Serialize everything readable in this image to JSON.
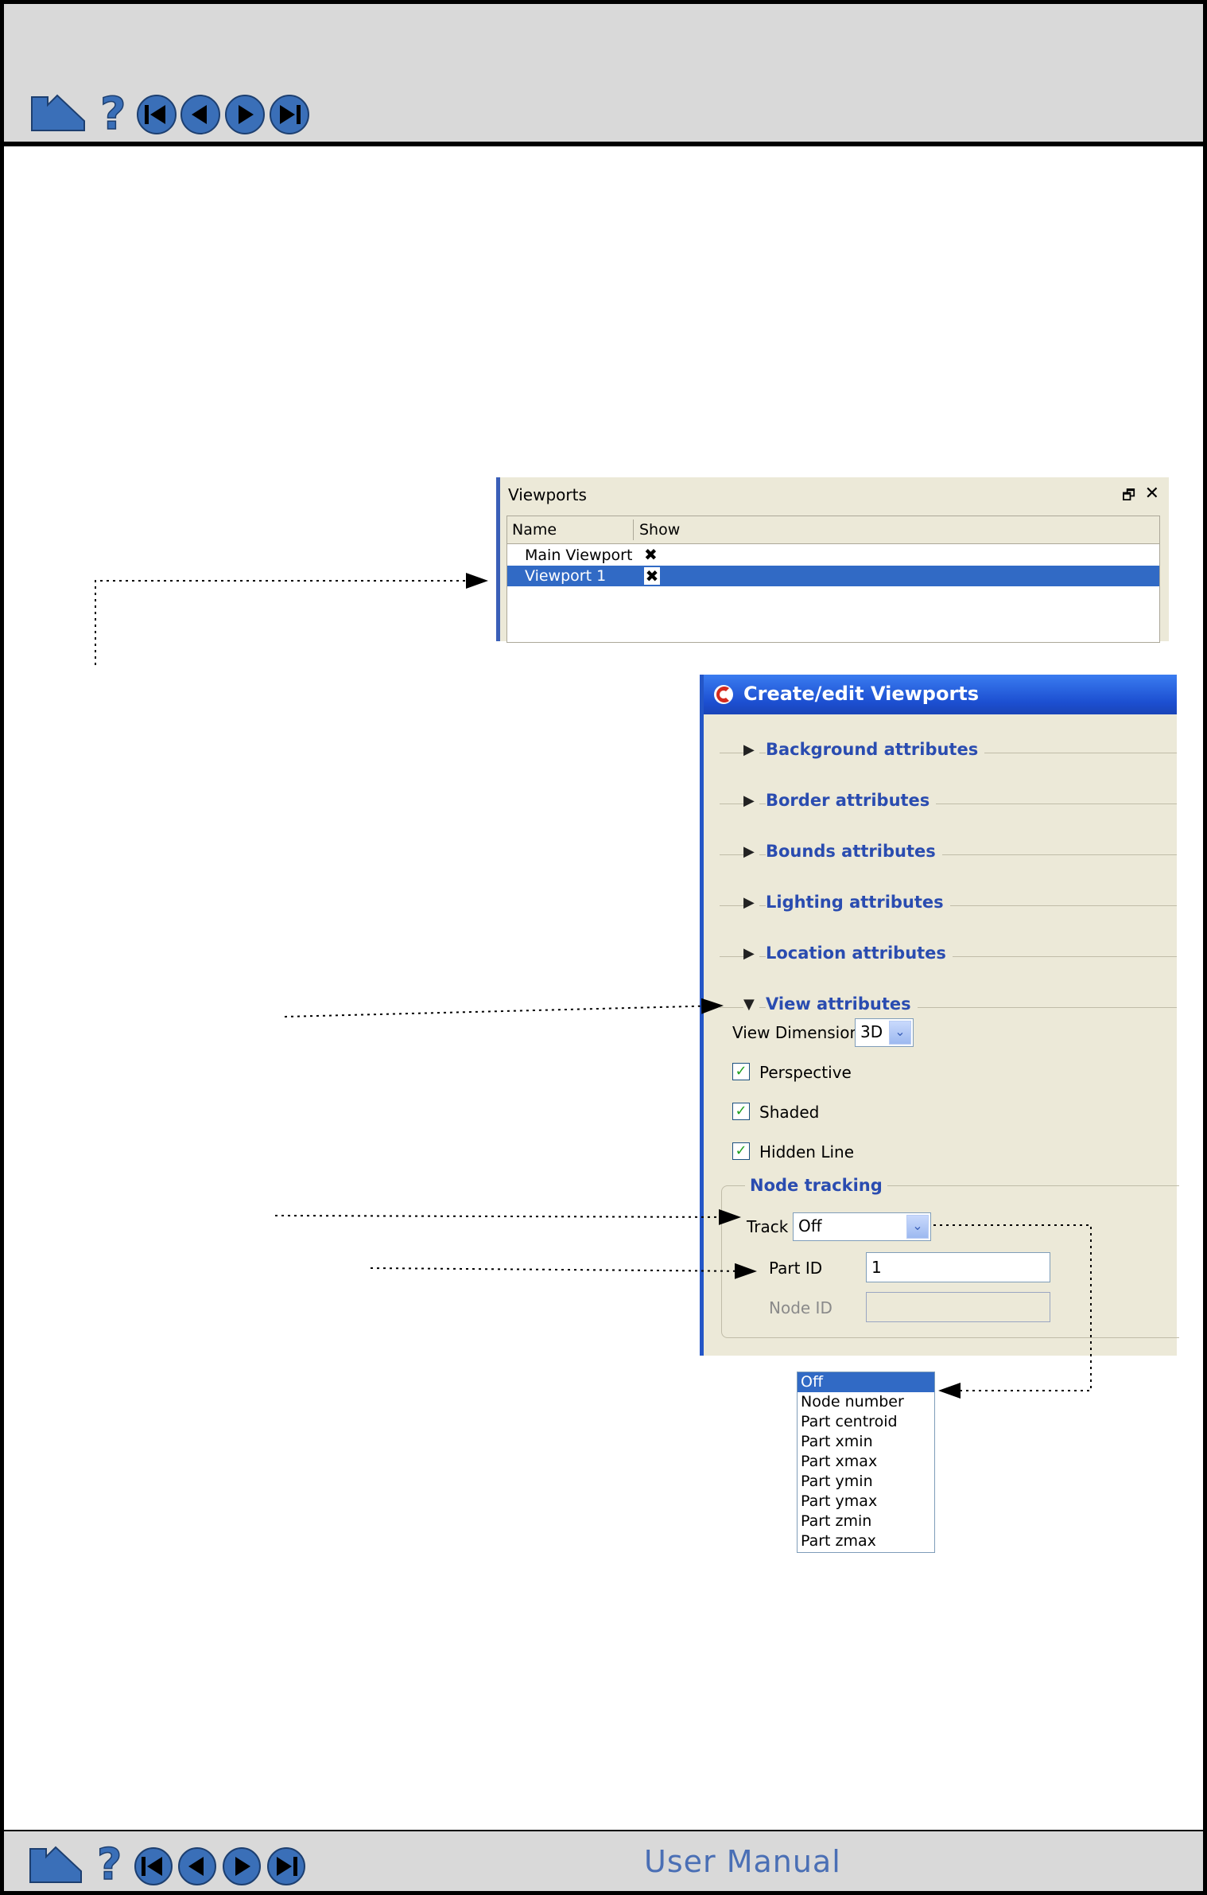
{
  "nav": {
    "icons": [
      "home-icon",
      "help-icon",
      "first-page-icon",
      "previous-page-icon",
      "next-page-icon",
      "last-page-icon"
    ],
    "footer_label": "User Manual"
  },
  "viewports_panel": {
    "title": "Viewports",
    "columns": [
      "Name",
      "Show"
    ],
    "rows": [
      {
        "name": "Main Viewport",
        "show": "✖",
        "selected": false
      },
      {
        "name": "Viewport 1",
        "show": "✖",
        "selected": true
      }
    ]
  },
  "dialog": {
    "title": "Create/edit Viewports",
    "sections": [
      {
        "label": "Background attributes",
        "expanded": false
      },
      {
        "label": "Border attributes",
        "expanded": false
      },
      {
        "label": "Bounds attributes",
        "expanded": false
      },
      {
        "label": "Lighting attributes",
        "expanded": false
      },
      {
        "label": "Location attributes",
        "expanded": false
      },
      {
        "label": "View attributes",
        "expanded": true
      }
    ],
    "view_dimension": {
      "label": "View Dimension",
      "value": "3D"
    },
    "checkboxes": [
      {
        "label": "Perspective",
        "checked": true
      },
      {
        "label": "Shaded",
        "checked": true
      },
      {
        "label": "Hidden Line",
        "checked": true
      }
    ],
    "node_tracking": {
      "label": "Node tracking",
      "track_label": "Track",
      "track_value": "Off",
      "part_id_label": "Part ID",
      "part_id_value": "1",
      "node_id_label": "Node ID",
      "node_id_value": ""
    }
  },
  "track_options": {
    "items": [
      "Off",
      "Node number",
      "Part centroid",
      "Part xmin",
      "Part xmax",
      "Part ymin",
      "Part ymax",
      "Part zmin",
      "Part zmax"
    ],
    "selected": "Off"
  },
  "colors": {
    "accent": "#2a4cb0",
    "selection": "#316ac5",
    "dialog_bg": "#ece9d8",
    "titlebar": "#1c4fd1"
  }
}
